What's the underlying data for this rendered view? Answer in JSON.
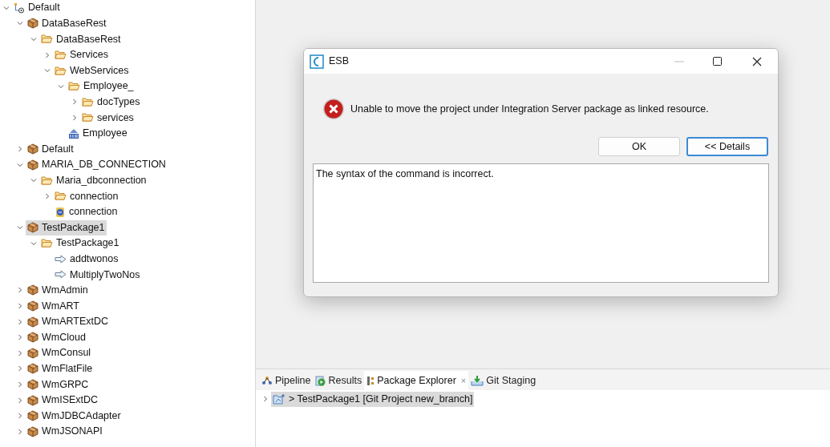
{
  "tree": [
    {
      "label": "Default",
      "kind": "workspace",
      "expanded": true,
      "selected": false,
      "children": [
        {
          "label": "DataBaseRest",
          "kind": "package",
          "expanded": true,
          "selected": false,
          "children": [
            {
              "label": "DataBaseRest",
              "kind": "folder",
              "expanded": true,
              "selected": false,
              "children": [
                {
                  "label": "Services",
                  "kind": "folder",
                  "expanded": false,
                  "selected": false
                },
                {
                  "label": "WebServices",
                  "kind": "folder",
                  "expanded": true,
                  "selected": false,
                  "children": [
                    {
                      "label": "Employee_",
                      "kind": "folder",
                      "expanded": true,
                      "selected": false,
                      "children": [
                        {
                          "label": "docTypes",
                          "kind": "folder",
                          "expanded": false,
                          "selected": false
                        },
                        {
                          "label": "services",
                          "kind": "folder",
                          "expanded": false,
                          "selected": false
                        }
                      ]
                    },
                    {
                      "label": "Employee",
                      "kind": "rest",
                      "selected": false
                    }
                  ]
                }
              ]
            }
          ]
        },
        {
          "label": "Default",
          "kind": "package",
          "expanded": false,
          "selected": false
        },
        {
          "label": "MARIA_DB_CONNECTION",
          "kind": "package",
          "expanded": true,
          "selected": false,
          "children": [
            {
              "label": "Maria_dbconnection",
              "kind": "folder",
              "expanded": true,
              "selected": false,
              "children": [
                {
                  "label": "connection",
                  "kind": "folder",
                  "expanded": false,
                  "selected": false
                },
                {
                  "label": "connection",
                  "kind": "adapter",
                  "selected": false
                }
              ]
            }
          ]
        },
        {
          "label": "TestPackage1",
          "kind": "package",
          "expanded": true,
          "selected": true,
          "children": [
            {
              "label": "TestPackage1",
              "kind": "folder",
              "expanded": true,
              "selected": false,
              "children": [
                {
                  "label": "addtwonos",
                  "kind": "service",
                  "selected": false
                },
                {
                  "label": "MultiplyTwoNos",
                  "kind": "service",
                  "selected": false
                }
              ]
            }
          ]
        },
        {
          "label": "WmAdmin",
          "kind": "package",
          "expanded": false,
          "selected": false
        },
        {
          "label": "WmART",
          "kind": "package",
          "expanded": false,
          "selected": false
        },
        {
          "label": "WmARTExtDC",
          "kind": "package",
          "expanded": false,
          "selected": false
        },
        {
          "label": "WmCloud",
          "kind": "package",
          "expanded": false,
          "selected": false
        },
        {
          "label": "WmConsul",
          "kind": "package",
          "expanded": false,
          "selected": false
        },
        {
          "label": "WmFlatFile",
          "kind": "package",
          "expanded": false,
          "selected": false
        },
        {
          "label": "WmGRPC",
          "kind": "package",
          "expanded": false,
          "selected": false
        },
        {
          "label": "WmISExtDC",
          "kind": "package",
          "expanded": false,
          "selected": false
        },
        {
          "label": "WmJDBCAdapter",
          "kind": "package",
          "expanded": false,
          "selected": false
        },
        {
          "label": "WmJSONAPI",
          "kind": "package",
          "expanded": false,
          "selected": false
        }
      ]
    }
  ],
  "bottom_panel": {
    "tabs": [
      {
        "label": "Pipeline",
        "kind": "pipeline",
        "selected": false
      },
      {
        "label": "Results",
        "kind": "results",
        "selected": false
      },
      {
        "label": "Package Explorer",
        "kind": "explorer",
        "selected": true,
        "close": "×"
      },
      {
        "label": "Git Staging",
        "kind": "git",
        "selected": false
      }
    ],
    "rows": [
      {
        "label": "> TestPackage1 [Git Project new_branch]",
        "expanded": false,
        "selected": true
      }
    ]
  },
  "dialog": {
    "title": "ESB",
    "message": "Unable to move the project under Integration Server package as linked resource.",
    "buttons": [
      {
        "label": "OK",
        "default": false
      },
      {
        "label": "<< Details",
        "default": true
      }
    ],
    "details": "The syntax of the command is incorrect."
  }
}
